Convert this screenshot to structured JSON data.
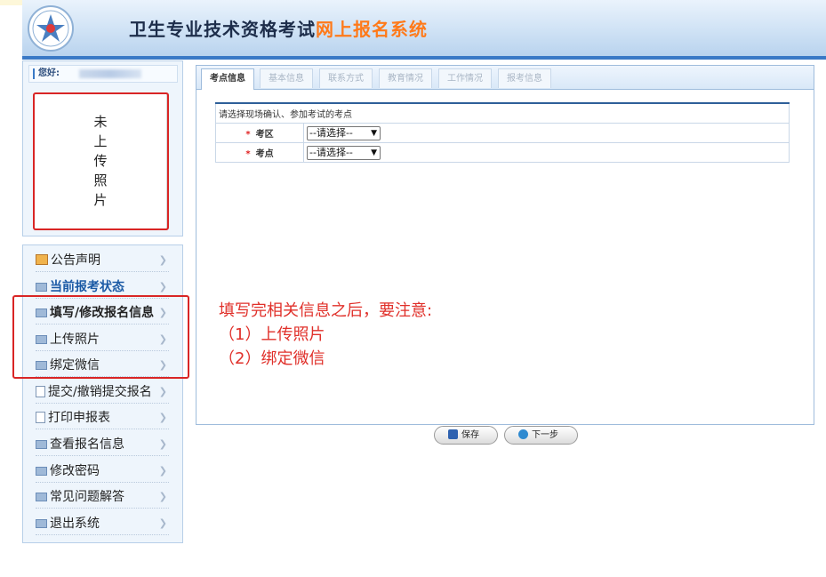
{
  "header": {
    "title_main": "卫生专业技术资格考试",
    "title_highlight": "网上报名系统"
  },
  "user": {
    "greeting": "您好:",
    "photo_status": [
      "未",
      "上",
      "传",
      "照",
      "片"
    ]
  },
  "menu": [
    {
      "label": "公告声明",
      "icon": "home-icon"
    },
    {
      "label": "当前报考状态",
      "icon": "card-icon"
    },
    {
      "label": "填写/修改报名信息",
      "icon": "card-icon"
    },
    {
      "label": "上传照片",
      "icon": "card-icon"
    },
    {
      "label": "绑定微信",
      "icon": "card-icon"
    },
    {
      "label": "提交/撤销提交报名",
      "icon": "document-icon"
    },
    {
      "label": "打印申报表",
      "icon": "document-icon"
    },
    {
      "label": "查看报名信息",
      "icon": "card-icon"
    },
    {
      "label": "修改密码",
      "icon": "card-icon"
    },
    {
      "label": "常见问题解答",
      "icon": "card-icon"
    },
    {
      "label": "退出系统",
      "icon": "card-icon"
    }
  ],
  "tabs": [
    "考点信息",
    "基本信息",
    "联系方式",
    "教育情况",
    "工作情况",
    "报考信息"
  ],
  "form": {
    "heading": "请选择现场确认、参加考试的考点",
    "required_mark": "*",
    "fields": [
      {
        "label": "考区",
        "value": "--请选择--"
      },
      {
        "label": "考点",
        "value": "--请选择--"
      }
    ]
  },
  "buttons": {
    "save": "保存",
    "next": "下一步"
  },
  "annotation": {
    "line1": "填写完相关信息之后，要注意:",
    "line2": "（1）上传照片",
    "line3": "（2）绑定微信"
  },
  "colors": {
    "accent": "#3a79c6",
    "highlight_title": "#ff7a1a",
    "annotation_red": "#d92525"
  }
}
